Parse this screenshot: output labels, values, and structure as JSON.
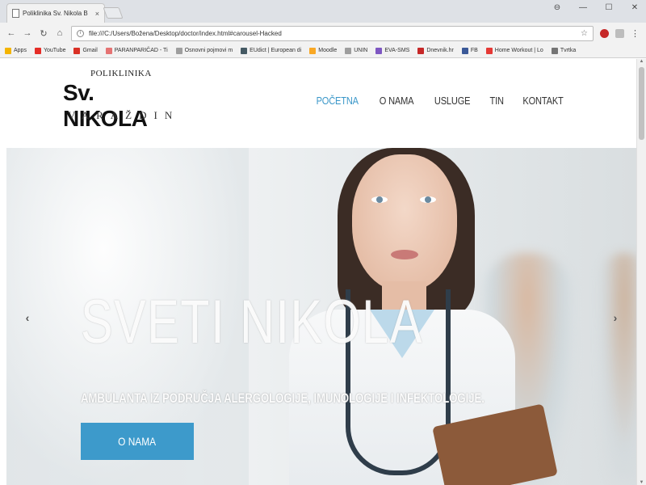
{
  "browser": {
    "tab_title": "Poliklinika Sv. Nikola B",
    "tab_close": "×",
    "url": "file:///C:/Users/Božena/Desktop/doctor/index.html#carousel-Hacked",
    "window_controls": [
      "⊖",
      "—",
      "☐",
      "✕"
    ],
    "bookmarks": [
      {
        "label": "Apps",
        "color": "#f4b400"
      },
      {
        "label": "YouTube",
        "color": "#e52d27"
      },
      {
        "label": "Gmail",
        "color": "#d93025"
      },
      {
        "label": "PARANPARIČAD - Ti",
        "color": "#e57373"
      },
      {
        "label": "Osnovni pojmovi m",
        "color": "#9e9e9e"
      },
      {
        "label": "EUdict | European di",
        "color": "#455a64"
      },
      {
        "label": "Moodle",
        "color": "#f9a825"
      },
      {
        "label": "UNIN",
        "color": "#9e9e9e"
      },
      {
        "label": "EVA-SMS",
        "color": "#7e57c2"
      },
      {
        "label": "Dnevnik.hr",
        "color": "#c62828"
      },
      {
        "label": "FB",
        "color": "#3b5998"
      },
      {
        "label": "Home Workout | Lo",
        "color": "#e53935"
      },
      {
        "label": "Tvrtka",
        "color": "#757575"
      }
    ]
  },
  "site": {
    "logo": {
      "top": "POLIKLINIKA",
      "main": "Sv. NIKOLA",
      "sub": "VARAŽDIN"
    },
    "nav": [
      {
        "label": "POČETNA",
        "active": true
      },
      {
        "label": "O NAMA",
        "active": false
      },
      {
        "label": "USLUGE",
        "active": false
      },
      {
        "label": "TIN",
        "active": false
      },
      {
        "label": "KONTAKT",
        "active": false
      }
    ],
    "hero": {
      "title": "SVETI NIKOLA",
      "subtitle": "AMBULANTA IZ PODRUČJA ALERGOLOGIJE, IMUNOLOGIJE I INFEKTOLOGIJE.",
      "button": "O NAMA",
      "prev": "‹",
      "next": "›"
    }
  },
  "colors": {
    "accent": "#3d9acb",
    "nav_active": "#3a97c9"
  }
}
